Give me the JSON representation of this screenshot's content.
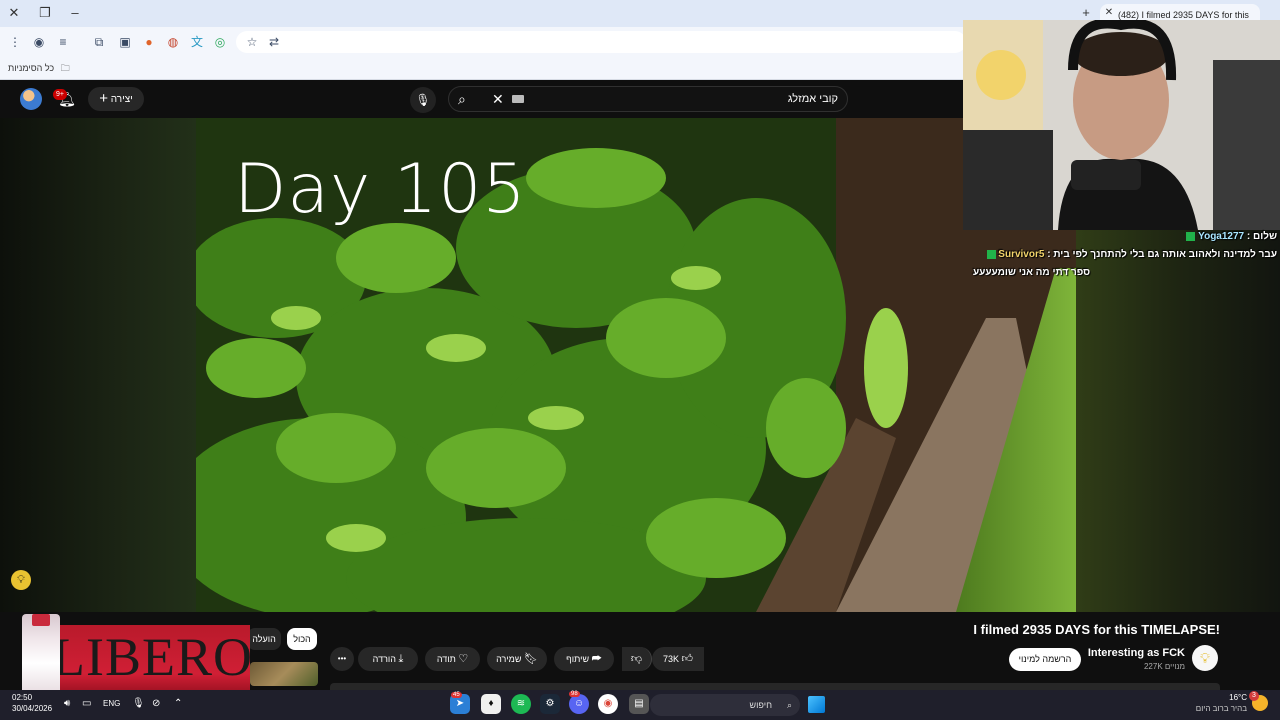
{
  "browser": {
    "tab_title": "(482) I filmed 2935 DAYS for this",
    "bookmarks_label": "כל הסימניות"
  },
  "youtube": {
    "create_label": "יצירה",
    "notifications_count": "9+",
    "search_query": "קובי אמזלג",
    "video_overlay_text": "Day 105",
    "title": "I filmed 2935 DAYS for this TIMELAPSE!",
    "channel_name": "Interesting as FCK",
    "subscribers": "227K מנויים",
    "subscribe_label": "הרשמה למינוי",
    "like_count": "73K",
    "share_label": "שיתוף",
    "save_label": "שמירה",
    "thanks_label": "תודה",
    "download_label": "הורדה",
    "more_label": "•••",
    "chip_all": "הכול",
    "chip_uploaded": "הועלה"
  },
  "stream_chat": [
    {
      "user": "Yoga1277",
      "message": "שלום",
      "user_color": "#a8e6ff"
    },
    {
      "user": "Survivor5",
      "message": "ספר דתי מה אני שומעעעע",
      "line2": "עבר למדינה ולאהוב אותה גם בלי להתחנך לפי בית",
      "user_color": "#f3d46b"
    }
  ],
  "ad": {
    "brand": "LIBERO",
    "bottle_label": "LIBERO"
  },
  "taskbar": {
    "time": "02:50",
    "date": "30/04/2026",
    "language": "ENG",
    "search_label": "חיפוש",
    "weather_temp": "16°C",
    "weather_desc": "בהיר ברוב היום",
    "weather_badge": "3",
    "app_badge_1": "45",
    "app_badge_2": "98"
  },
  "icons": [
    "close-icon",
    "maximize-icon",
    "minimize-icon",
    "menu-icon",
    "extensions-icon",
    "star-icon",
    "search-icon",
    "mic-icon",
    "bell-icon",
    "plus-icon",
    "like-icon",
    "dislike-icon",
    "share-icon",
    "save-icon",
    "download-icon",
    "thanks-icon",
    "windows-start-icon",
    "weather-icon"
  ],
  "colors": {
    "youtube_bg": "#0f0f0f",
    "chrome_tabstrip": "#dfe8f7",
    "ad_red": "#d01f35",
    "chat_badge_green": "#21b34a"
  }
}
